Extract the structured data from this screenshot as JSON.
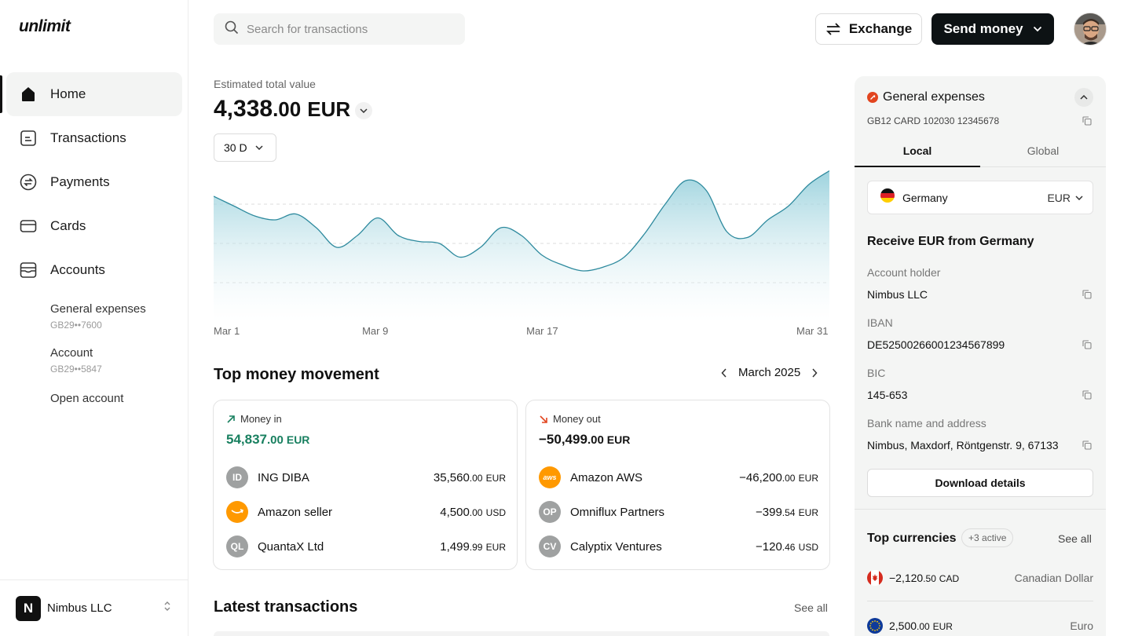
{
  "brand": {
    "logo": "unlimit"
  },
  "sidebar": {
    "items": [
      {
        "label": "Home",
        "icon": "home-icon",
        "active": true
      },
      {
        "label": "Transactions",
        "icon": "document-icon"
      },
      {
        "label": "Payments",
        "icon": "exchange-circle-icon"
      },
      {
        "label": "Cards",
        "icon": "card-icon"
      },
      {
        "label": "Accounts",
        "icon": "accounts-icon"
      }
    ],
    "sub_items": [
      {
        "name": "General expenses",
        "account": "GB29••7600"
      },
      {
        "name": "Account",
        "account": "GB29••5847"
      },
      {
        "name": "Open account"
      }
    ],
    "company": {
      "initial": "N",
      "name": "Nimbus LLC"
    }
  },
  "header": {
    "search_placeholder": "Search for transactions",
    "exchange_label": "Exchange",
    "send_label": "Send money"
  },
  "summary": {
    "label": "Estimated total value",
    "amount_int": "4,338",
    "amount_dec": ".00",
    "currency": "EUR",
    "period": "30 D"
  },
  "chart_data": {
    "type": "area",
    "x": [
      "Mar 1",
      "Mar 2",
      "Mar 3",
      "Mar 4",
      "Mar 5",
      "Mar 6",
      "Mar 7",
      "Mar 8",
      "Mar 9",
      "Mar 10",
      "Mar 11",
      "Mar 12",
      "Mar 13",
      "Mar 14",
      "Mar 15",
      "Mar 16",
      "Mar 17",
      "Mar 18",
      "Mar 19",
      "Mar 20",
      "Mar 21",
      "Mar 22",
      "Mar 23",
      "Mar 24",
      "Mar 25",
      "Mar 26",
      "Mar 27",
      "Mar 28",
      "Mar 29",
      "Mar 30",
      "Mar 31"
    ],
    "values": [
      6.4,
      5.9,
      5.4,
      5.2,
      5.5,
      4.8,
      3.8,
      4.4,
      5.3,
      4.4,
      4.1,
      4.0,
      3.3,
      3.8,
      4.8,
      4.4,
      3.4,
      2.9,
      2.6,
      2.8,
      3.3,
      4.5,
      6.0,
      7.2,
      6.7,
      4.6,
      4.3,
      5.2,
      5.9,
      7.0,
      7.7
    ],
    "x_ticks": [
      "Mar 1",
      "Mar 9",
      "Mar 17",
      "Mar 31"
    ],
    "ylim": [
      0,
      8
    ],
    "grid": true,
    "colors": {
      "line": "#2e8a9e",
      "fill_top": "#8ccbd8",
      "fill_bottom": "#ffffff"
    }
  },
  "movement": {
    "title": "Top money movement",
    "month": "March 2025",
    "in": {
      "label": "Money in",
      "total_int": "54,837",
      "total_dec": ".00",
      "total_cur": "EUR",
      "color": "#198060",
      "rows": [
        {
          "avatar": "ID",
          "name": "ING DIBA",
          "int": "35,560",
          "dec": ".00",
          "cur": "EUR"
        },
        {
          "avatar": "",
          "name": "Amazon seller",
          "int": "4,500",
          "dec": ".00",
          "cur": "USD",
          "avatar_color": "#ff9900"
        },
        {
          "avatar": "QL",
          "name": "QuantaX Ltd",
          "int": "1,499",
          "dec": ".99",
          "cur": "EUR"
        }
      ]
    },
    "out": {
      "label": "Money out",
      "total_int": "−50,499",
      "total_dec": ".00",
      "total_cur": "EUR",
      "rows": [
        {
          "avatar": "aws",
          "name": "Amazon AWS",
          "int": "−46,200",
          "dec": ".00",
          "cur": "EUR",
          "avatar_color": "#ff9900"
        },
        {
          "avatar": "OP",
          "name": "Omniflux Partners",
          "int": "−399",
          "dec": ".54",
          "cur": "EUR"
        },
        {
          "avatar": "CV",
          "name": "Calyptix Ventures",
          "int": "−120",
          "dec": ".46",
          "cur": "USD"
        }
      ]
    }
  },
  "latest": {
    "title": "Latest transactions",
    "see_all": "See all"
  },
  "panel": {
    "title": "General expenses",
    "card_number": "GB12 CARD 102030 12345678",
    "tabs": [
      "Local",
      "Global"
    ],
    "country": "Germany",
    "currency": "EUR",
    "receive_title": "Receive EUR from Germany",
    "fields": [
      {
        "label": "Account holder",
        "value": "Nimbus LLC"
      },
      {
        "label": "IBAN",
        "value": "DE52500266001234567899"
      },
      {
        "label": "BIC",
        "value": "145-653"
      },
      {
        "label": "Bank name and address",
        "value": "Nimbus, Maxdorf, Röntgenstr. 9, 67133"
      }
    ],
    "download_label": "Download details",
    "top_currencies": {
      "title": "Top currencies",
      "badge": "+3 active",
      "see_all": "See all",
      "rows": [
        {
          "flag": "canada-flag",
          "int": "−2,120",
          "dec": ".50",
          "cur": "CAD",
          "name": "Canadian Dollar"
        },
        {
          "flag": "eu-flag",
          "int": "2,500",
          "dec": ".00",
          "cur": "EUR",
          "name": "Euro"
        }
      ]
    }
  }
}
